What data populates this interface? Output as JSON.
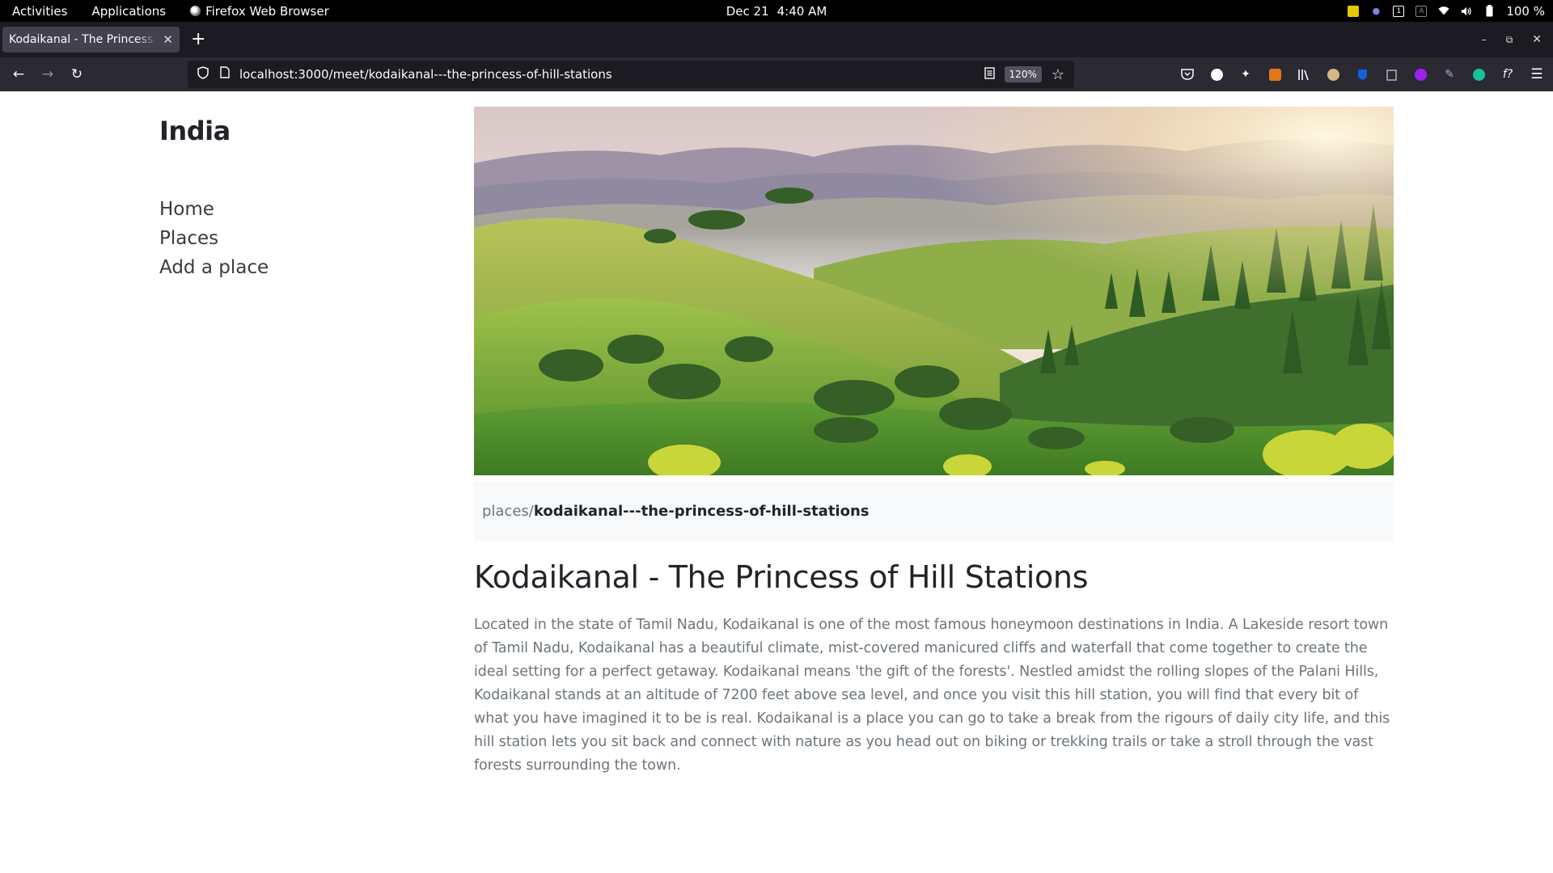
{
  "system_bar": {
    "activities": "Activities",
    "applications": "Applications",
    "active_app": "Firefox Web Browser",
    "date": "Dec 21",
    "time": "4:40 AM",
    "battery": "100 %"
  },
  "browser": {
    "tab_title": "Kodaikanal - The Princess of Hill Stations",
    "url": "localhost:3000/meet/kodaikanal---the-princess-of-hill-stations",
    "zoom": "120%"
  },
  "site": {
    "title": "India",
    "nav": [
      {
        "label": "Home"
      },
      {
        "label": "Places"
      },
      {
        "label": "Add a place"
      }
    ]
  },
  "place": {
    "breadcrumb_parent": "places/",
    "breadcrumb_current": "kodaikanal---the-princess-of-hill-stations",
    "title": "Kodaikanal - The Princess of Hill Stations",
    "description": "Located in the state of Tamil Nadu, Kodaikanal is one of the most famous honeymoon destinations in India. A Lakeside resort town of Tamil Nadu, Kodaikanal has a beautiful climate, mist-covered manicured cliffs and waterfall that come together to create the ideal setting for a perfect getaway. Kodaikanal means 'the gift of the forests'. Nestled amidst the rolling slopes of the Palani Hills, Kodaikanal stands at an altitude of 7200 feet above sea level, and once you visit this hill station, you will find that every bit of what you have imagined it to be is real. Kodaikanal is a place you can go to take a break from the rigours of daily city life, and this hill station lets you sit back and connect with nature as you head out on biking or trekking trails or take a stroll through the vast forests surrounding the town."
  },
  "icons": {
    "back": "back-arrow-icon",
    "forward": "forward-arrow-icon",
    "reload": "reload-icon",
    "shield": "tracking-protection-shield-icon",
    "page": "page-info-icon",
    "reader": "reader-view-icon",
    "bookmark": "bookmark-star-icon",
    "menu": "hamburger-menu-icon"
  },
  "colors": {
    "topbar_bg": "#000000",
    "tabstrip_bg": "#1c1b22",
    "toolbar_bg": "#2b2a33",
    "text_dark": "#212529",
    "text_muted": "#6c757d",
    "breadcrumb_bg": "#f8f9fa"
  }
}
